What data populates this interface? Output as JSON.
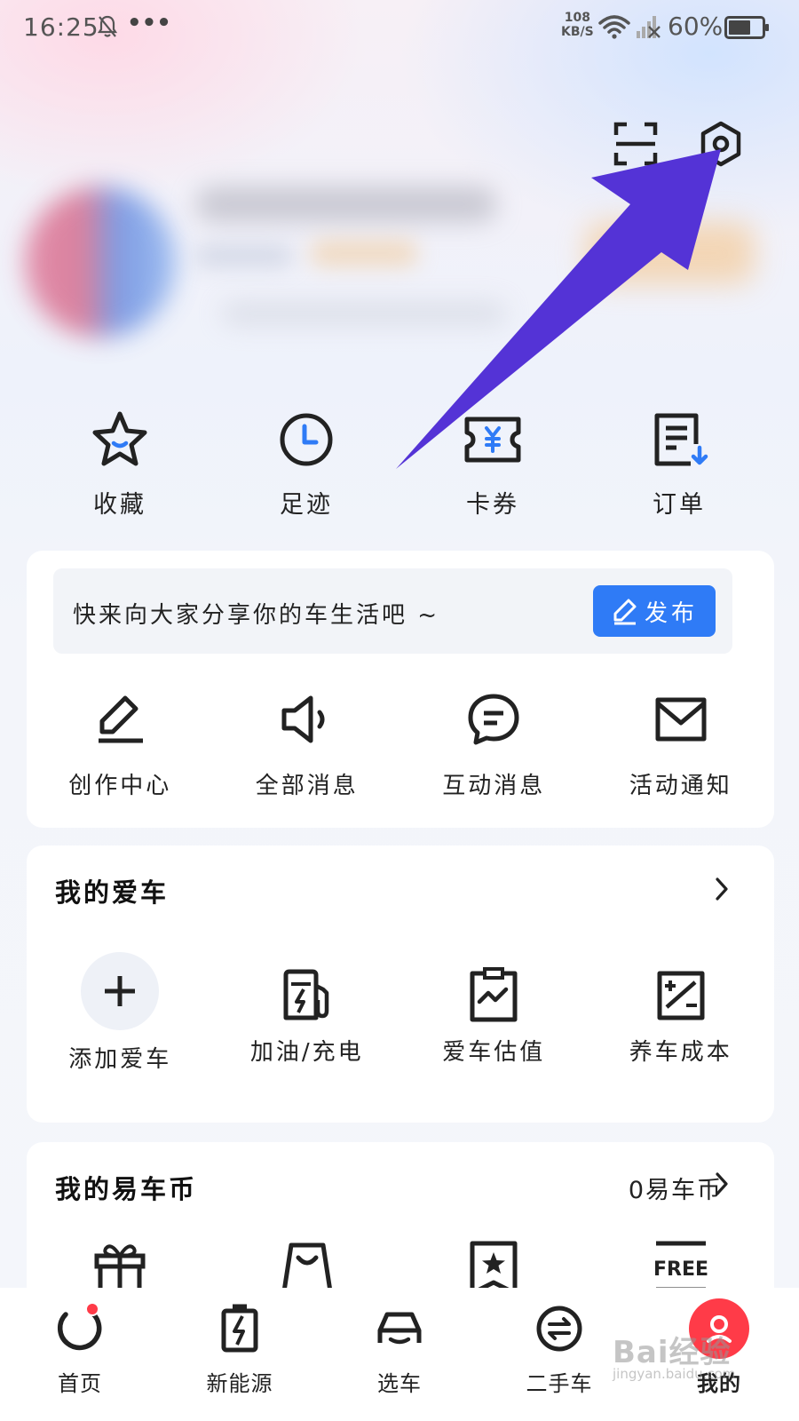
{
  "status_bar": {
    "time": "16:25",
    "more": "•••",
    "net_speed_value": "108",
    "net_speed_unit": "KB/S",
    "battery": "60%"
  },
  "header": {
    "scan_icon": "scan-icon",
    "settings_icon": "settings-hex-icon"
  },
  "quick_entries": [
    {
      "label": "收藏",
      "icon": "star-icon"
    },
    {
      "label": "足迹",
      "icon": "clock-icon"
    },
    {
      "label": "卡券",
      "icon": "coupon-icon"
    },
    {
      "label": "订单",
      "icon": "order-icon"
    }
  ],
  "share": {
    "prompt": "快来向大家分享你的车生活吧 ~",
    "publish_label": "发布"
  },
  "messages": [
    {
      "label": "创作中心",
      "icon": "pen-icon"
    },
    {
      "label": "全部消息",
      "icon": "speaker-icon"
    },
    {
      "label": "互动消息",
      "icon": "chat-icon"
    },
    {
      "label": "活动通知",
      "icon": "mail-icon"
    }
  ],
  "my_car": {
    "title": "我的爱车",
    "items": [
      {
        "label": "添加爱车",
        "icon": "plus-icon"
      },
      {
        "label": "加油/充电",
        "icon": "fuel-icon"
      },
      {
        "label": "爱车估值",
        "icon": "valuation-icon"
      },
      {
        "label": "养车成本",
        "icon": "cost-icon"
      }
    ]
  },
  "coins": {
    "title": "我的易车币",
    "balance": "0易车币",
    "items": [
      {
        "icon": "gift-icon"
      },
      {
        "icon": "bag-icon"
      },
      {
        "icon": "star-bookmark-icon"
      },
      {
        "icon": "free-icon",
        "text": "FREE"
      }
    ]
  },
  "tabbar": [
    {
      "label": "首页",
      "icon": "home-icon"
    },
    {
      "label": "新能源",
      "icon": "battery-icon"
    },
    {
      "label": "选车",
      "icon": "car-icon"
    },
    {
      "label": "二手车",
      "icon": "exchange-icon"
    },
    {
      "label": "我的",
      "icon": "me-icon"
    }
  ],
  "watermark": {
    "text": "Bai经验",
    "url": "jingyan.baidu.com"
  },
  "colors": {
    "accent": "#2f7bf6",
    "arrow": "#5433d6",
    "badge": "#ff3b48"
  }
}
